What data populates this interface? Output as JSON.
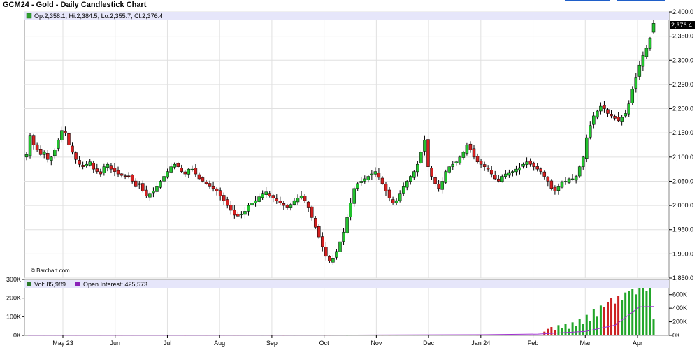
{
  "header": {
    "title": "GCM24 - Gold - Daily Candlestick Chart"
  },
  "ohlc_legend": {
    "open_label": "Op:",
    "open": "2,358.1",
    "high_label": "Hi:",
    "high": "2,384.5",
    "low_label": "Lo:",
    "low": "2,355.7",
    "close_label": "Cl:",
    "close": "2,376.4",
    "text": "Op:2,358.1, Hi:2,384.5, Lo:2,355.7, Cl:2,376.4"
  },
  "last_price_tag": "2,376.4",
  "copyright": "© Barchart.com",
  "volume_legend": {
    "vol_text": "Vol: 85,989",
    "oi_text": "Open Interest: 425,573"
  },
  "colors": {
    "up": "#22c22e",
    "down": "#d42020",
    "volume_up": "#22a62a",
    "volume_down": "#cc2222",
    "open_interest": "#a030d0",
    "legend_bg": "#e6e6fa",
    "grid": "#e0e0e0",
    "border": "#888888",
    "vol_swatch": "#2a7a2a",
    "oi_swatch": "#8a22b8"
  },
  "chart_data": [
    {
      "type": "candlestick",
      "title": "GCM24 - Gold - Daily Candlestick Chart",
      "y_ticks": [
        "2,400.0",
        "2,350.0",
        "2,300.0",
        "2,250.0",
        "2,200.0",
        "2,150.0",
        "2,100.0",
        "2,050.0",
        "2,000.0",
        "1,950.0",
        "1,900.0",
        "1,850.0"
      ],
      "ylim": [
        1850,
        2400
      ],
      "x_ticks": [
        "May 23",
        "Jun",
        "Jul",
        "Aug",
        "Sep",
        "Oct",
        "Nov",
        "Dec",
        "Jan 24",
        "Feb",
        "Mar",
        "Apr"
      ],
      "grid": true,
      "last": {
        "open": 2358.1,
        "high": 2384.5,
        "low": 2355.7,
        "close": 2376.4
      },
      "closes": [
        2105,
        2145,
        2125,
        2115,
        2105,
        2110,
        2095,
        2100,
        2115,
        2135,
        2155,
        2150,
        2125,
        2110,
        2095,
        2085,
        2080,
        2085,
        2090,
        2075,
        2070,
        2065,
        2080,
        2085,
        2075,
        2070,
        2065,
        2062,
        2060,
        2060,
        2050,
        2040,
        2045,
        2030,
        2020,
        2025,
        2030,
        2040,
        2050,
        2060,
        2070,
        2080,
        2085,
        2080,
        2070,
        2065,
        2075,
        2075,
        2065,
        2055,
        2050,
        2045,
        2040,
        2035,
        2030,
        2020,
        2010,
        2000,
        1990,
        1980,
        1978,
        1982,
        1988,
        2000,
        2005,
        2010,
        2018,
        2025,
        2028,
        2020,
        2015,
        2010,
        2005,
        2000,
        1995,
        2002,
        2010,
        2015,
        2020,
        2010,
        1995,
        1975,
        1955,
        1935,
        1915,
        1895,
        1885,
        1890,
        1905,
        1925,
        1945,
        1975,
        2005,
        2035,
        2045,
        2050,
        2055,
        2060,
        2065,
        2070,
        2058,
        2045,
        2030,
        2015,
        2005,
        2010,
        2025,
        2040,
        2050,
        2060,
        2070,
        2085,
        2110,
        2135,
        2080,
        2060,
        2045,
        2035,
        2050,
        2070,
        2080,
        2085,
        2090,
        2100,
        2110,
        2125,
        2115,
        2100,
        2090,
        2085,
        2080,
        2075,
        2065,
        2055,
        2050,
        2060,
        2065,
        2068,
        2070,
        2075,
        2078,
        2085,
        2090,
        2085,
        2080,
        2075,
        2070,
        2060,
        2050,
        2035,
        2030,
        2040,
        2048,
        2050,
        2055,
        2055,
        2060,
        2080,
        2100,
        2140,
        2165,
        2185,
        2195,
        2205,
        2200,
        2190,
        2185,
        2180,
        2175,
        2182,
        2190,
        2210,
        2240,
        2265,
        2290,
        2310,
        2325,
        2345,
        2376.4
      ],
      "open_interest": [
        {
          "month": "May 23",
          "value": 2000
        },
        {
          "month": "Jul",
          "value": 3000
        },
        {
          "month": "Sep",
          "value": 4000
        },
        {
          "month": "Nov",
          "value": 6000
        },
        {
          "month": "Jan 24",
          "value": 10000
        },
        {
          "month": "Feb",
          "value": 20000
        },
        {
          "month": "Mar",
          "value": 60000
        },
        {
          "month": "Mar",
          "value": 150000
        },
        {
          "month": "Apr",
          "value": 420000
        },
        {
          "month": "Apr",
          "value": 425573
        }
      ]
    },
    {
      "type": "bar",
      "title": "",
      "series": [
        {
          "name": "Vol",
          "last": 85989
        },
        {
          "name": "Open Interest",
          "last": 425573
        }
      ],
      "left_axis_ticks": [
        "300K",
        "200K",
        "100K",
        "0K"
      ],
      "left_ylim": [
        0,
        300000
      ],
      "right_axis_ticks": [
        "600K",
        "400K",
        "200K",
        "0K"
      ],
      "right_ylim": [
        0,
        700000
      ],
      "volume_recent": [
        20000,
        35000,
        45000,
        30000,
        55000,
        40000,
        60000,
        35000,
        70000,
        50000,
        90000,
        60000,
        110000,
        75000,
        140000,
        100000,
        160000,
        150000,
        180000,
        200000,
        170000,
        210000,
        190000,
        230000,
        240000,
        250000,
        220000,
        260000,
        265000,
        240000,
        255000,
        85989
      ]
    }
  ]
}
